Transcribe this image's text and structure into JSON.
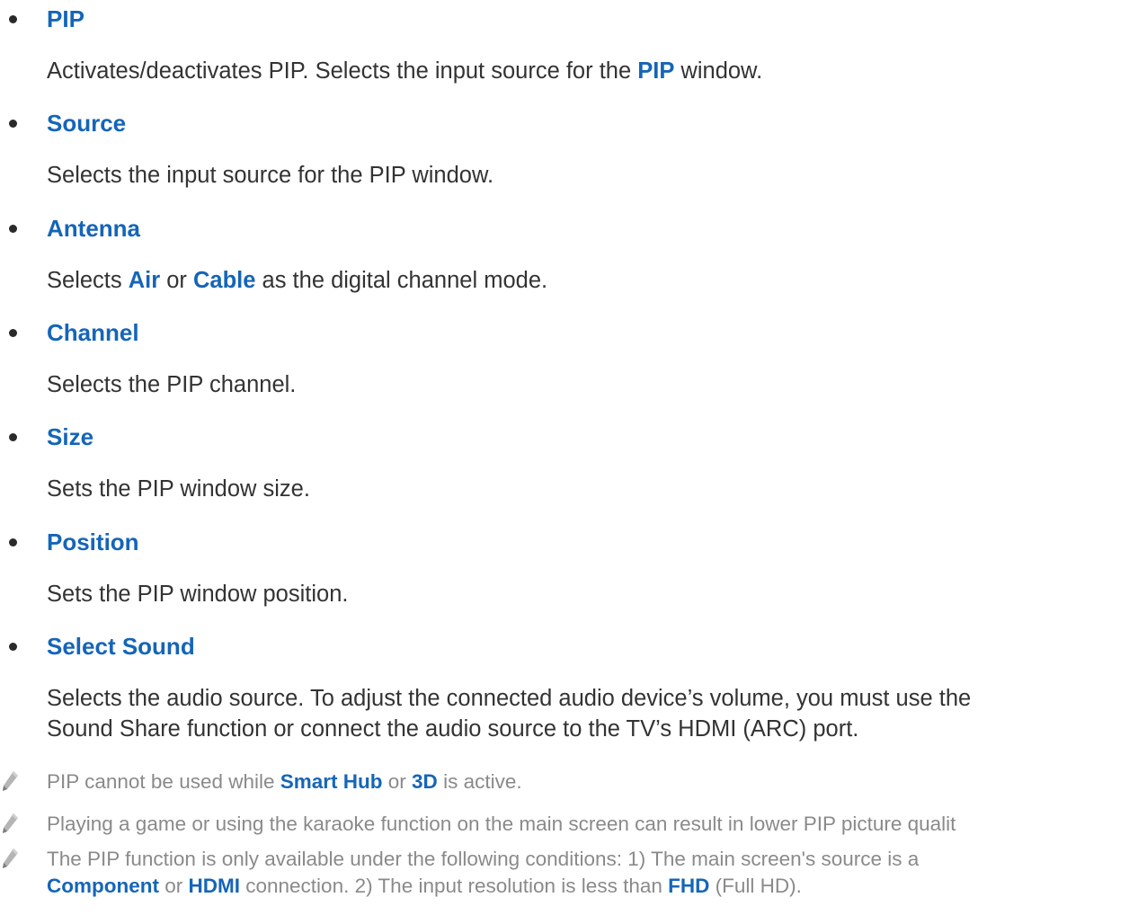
{
  "items": [
    {
      "title": "PIP",
      "desc": {
        "pre": "Activates/deactivates PIP. Selects the input source for the ",
        "hl": "PIP",
        "post": " window."
      }
    },
    {
      "title": "Source",
      "desc": "Selects the input source for the PIP window."
    },
    {
      "title": "Antenna",
      "desc": {
        "pre": "Selects ",
        "hl1": "Air",
        "mid": " or ",
        "hl2": "Cable",
        "post": " as the digital channel mode."
      }
    },
    {
      "title": "Channel",
      "desc": "Selects the PIP channel."
    },
    {
      "title": "Size",
      "desc": "Sets the PIP window size."
    },
    {
      "title": "Position",
      "desc": "Sets the PIP window position."
    },
    {
      "title": "Select Sound",
      "desc_lines": [
        "Selects the audio source. To adjust the connected audio device’s volume, you must use the",
        "Sound Share function or connect the audio source to the TV’s HDMI (ARC) port."
      ]
    }
  ],
  "notes": [
    {
      "pre": "PIP cannot be used while ",
      "hl1": "Smart Hub",
      "mid": " or ",
      "hl2": "3D",
      "post": " is active."
    },
    {
      "text": "Playing a game or using the karaoke function on the main screen can result in lower PIP picture qualit"
    },
    {
      "line1": "The PIP function is only available under the following conditions: 1) The main screen's source is a",
      "line2": {
        "hl1": "Component",
        "mid1": " or ",
        "hl2": "HDMI",
        "mid2": " connection. 2) The input resolution is less than ",
        "hl3": "FHD",
        "post": " (Full HD)."
      }
    }
  ],
  "icon": "pencil-note-icon"
}
